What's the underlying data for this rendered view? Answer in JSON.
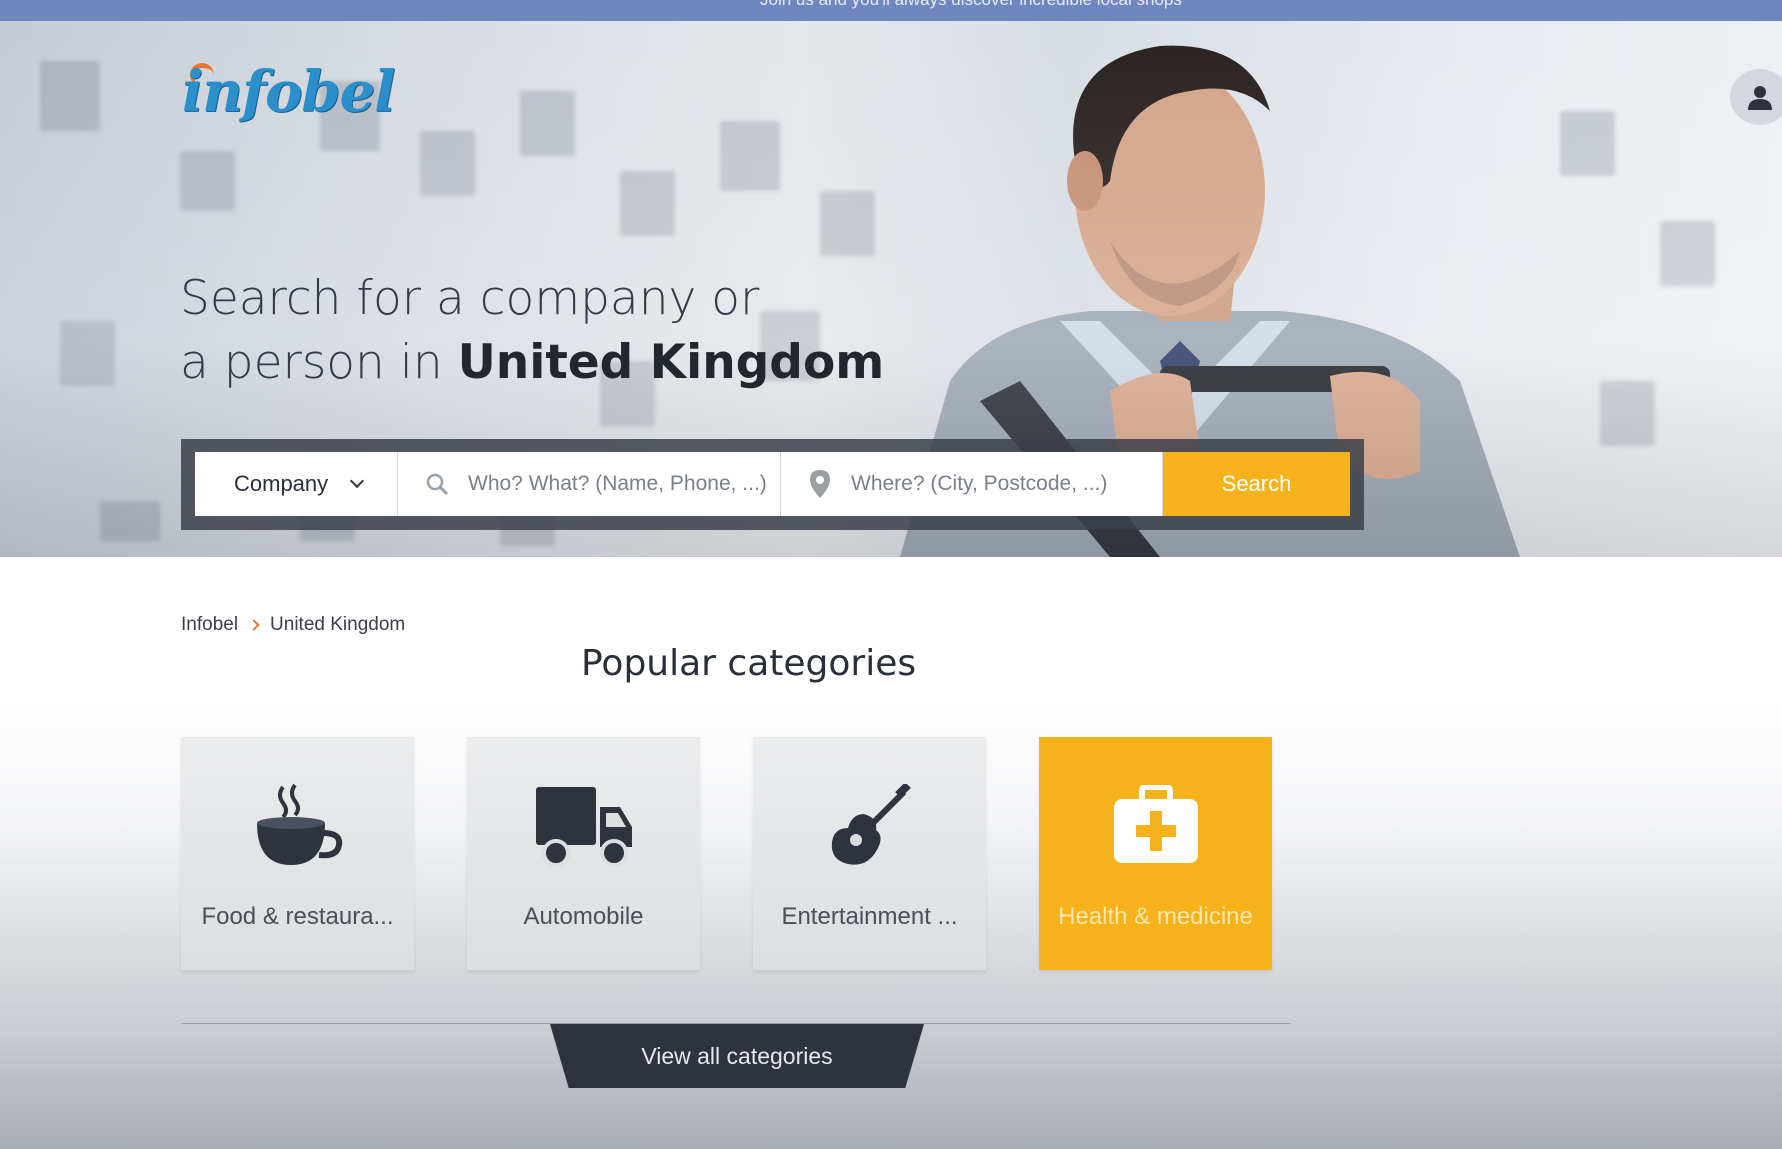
{
  "top_strip": {
    "text": "Join us and you'll always discover incredible local shops"
  },
  "header": {
    "logo_text": "infobel",
    "account_icon": "user-icon"
  },
  "hero": {
    "headline_line1": "Search for a company or",
    "headline_line2_prefix": "a person in ",
    "headline_country": "United Kingdom"
  },
  "search": {
    "type_selected": "Company",
    "who_placeholder": "Who? What? (Name, Phone, ...)",
    "where_placeholder": "Where? (City, Postcode, ...)",
    "button_label": "Search",
    "who_icon": "search-icon",
    "where_icon": "map-pin-icon"
  },
  "breadcrumb": {
    "items": [
      "Infobel",
      "United Kingdom"
    ]
  },
  "categories": {
    "title": "Popular categories",
    "items": [
      {
        "label": "Food & restaura...",
        "icon": "coffee-cup-icon"
      },
      {
        "label": "Automobile",
        "icon": "truck-icon"
      },
      {
        "label": "Entertainment ...",
        "icon": "guitar-icon"
      },
      {
        "label": "Health & medicine",
        "icon": "first-aid-kit-icon",
        "highlighted": true
      }
    ],
    "view_all_label": "View all categories"
  },
  "colors": {
    "accent": "#f6b21b",
    "dark": "#2e333e",
    "top_strip": "#6f86bf",
    "logo_blue": "#2b8fcb",
    "logo_orange": "#e8772a"
  }
}
